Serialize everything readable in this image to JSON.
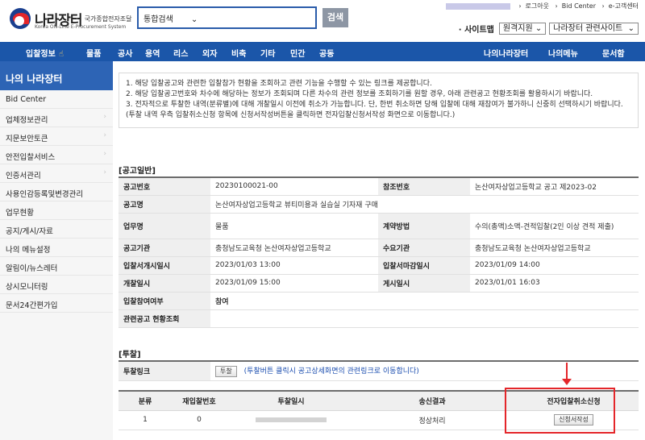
{
  "header": {
    "logo_main": "나라장터",
    "logo_small": "국가종합전자조달",
    "logo_sub": "Korea ON-Line E-Procurement System",
    "search_select": "통합검색",
    "search_button": "검색",
    "top_links": [
      "로그아웃",
      "Bid Center",
      "e-고객센터"
    ],
    "sitemap_label": "· 사이트맵",
    "remote_support": "원격지원",
    "related_sites": "나라장터 관련사이트"
  },
  "nav": {
    "items": [
      "입찰정보",
      "물품",
      "공사",
      "용역",
      "리스",
      "외자",
      "비축",
      "기타",
      "민간",
      "공동"
    ],
    "right_items": [
      "나의나라장터",
      "나의메뉴",
      "문서함"
    ]
  },
  "sidebar": {
    "title": "나의 나라장터",
    "items": [
      {
        "label": "Bid Center",
        "arrow": false
      },
      {
        "label": "업체정보관리",
        "arrow": true
      },
      {
        "label": "지문보안토큰",
        "arrow": true
      },
      {
        "label": "안전입찰서비스",
        "arrow": true
      },
      {
        "label": "인증서관리",
        "arrow": true
      },
      {
        "label": "사용인감등록및변경관리",
        "arrow": false
      },
      {
        "label": "업무현황",
        "arrow": false
      },
      {
        "label": "공지/게시/자료",
        "arrow": false
      },
      {
        "label": "나의 메뉴설정",
        "arrow": false
      },
      {
        "label": "알림이/뉴스레터",
        "arrow": false
      },
      {
        "label": "상시모니터링",
        "arrow": false
      },
      {
        "label": "문서24간편가입",
        "arrow": false
      }
    ]
  },
  "notice": {
    "lines": [
      "1. 해당 입찰공고와 관련한 입찰참가 현황을 조회하고 관련 기능을 수행할 수 있는 링크를 제공합니다.",
      "2. 해당 입찰공고번호와 차수에 해당하는 정보가 조회되며 다른 차수의 관련 정보를 조회하기를 원할 경우, 아래 관련공고 현황조회를 활용하시기 바랍니다.",
      "3. 전자적으로 투찰한 내역(분류별)에 대해 개찰일시 이전에 취소가 가능합니다. 단, 한번 취소하면 당해 입찰에 대해 재참여가 불가하니 신중히 선택하시기 바랍니다. (투찰 내역 우측 입찰취소신청 항목에 신청서작성버튼을 클릭하면 전자입찰신청서작성 화면으로 이동합니다.)"
    ]
  },
  "general": {
    "section_title": "[공고일반]",
    "bid_no_label": "공고번호",
    "bid_no": "20230100021-00",
    "ref_no_label": "참조번호",
    "ref_no": "논산여자상업고등학교 공고 제2023-02",
    "name_label": "공고명",
    "name": "논산여자상업고등학교 뷰티미용과 실습실 기자재 구매",
    "task_label": "업무명",
    "task": "물품",
    "contract_label": "계약방법",
    "contract": "수의(총액)소액-견적입찰(2인 이상 견적 제출)",
    "agency_label": "공고기관",
    "agency": "충청남도교육청 논산여자상업고등학교",
    "demand_label": "수요기관",
    "demand": "충청남도교육청 논산여자상업고등학교",
    "start_label": "입찰서개시일시",
    "start": "2023/01/03 13:00",
    "end_label": "입찰서마감일시",
    "end": "2023/01/09 14:00",
    "open_label": "개찰일시",
    "open": "2023/01/09 15:00",
    "post_label": "게시일시",
    "post": "2023/01/01 16:03",
    "participation_label": "입찰참여여부",
    "participation": "참여",
    "related_label": "관련공고 현황조회"
  },
  "bid": {
    "section_title": "[투찰]",
    "link_label": "투찰링크",
    "link_button": "투찰",
    "link_note": "(투찰버튼 클릭시 공고상세화면의 관련링크로 이동합니다)",
    "headers": [
      "분류",
      "재입찰번호",
      "투찰일시",
      "송신결과",
      "전자입찰취소신청"
    ],
    "rows": [
      {
        "category": "1",
        "rebid": "0",
        "result": "정상처리",
        "action": "신청서작성"
      }
    ]
  }
}
